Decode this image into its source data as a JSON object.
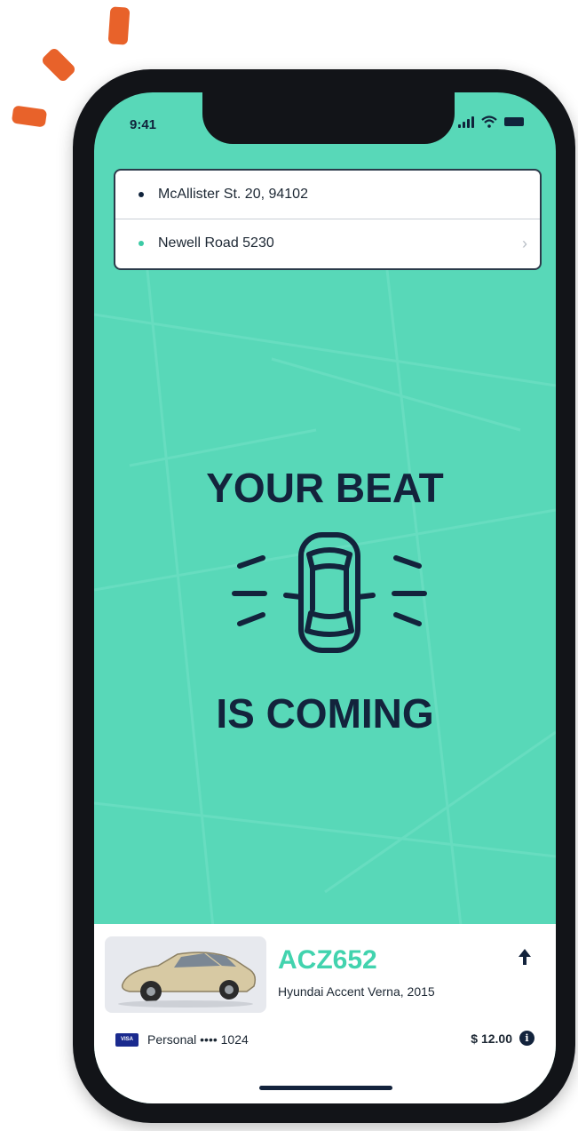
{
  "status_bar": {
    "time": "9:41"
  },
  "route": {
    "pickup": "McAllister St. 20, 94102",
    "destination": "Newell Road 5230"
  },
  "message": {
    "line1": "YOUR BEAT",
    "line2": "IS COMING"
  },
  "vehicle": {
    "plate": "ACZ652",
    "model": "Hyundai Accent Verna, 2015"
  },
  "payment": {
    "card_brand": "VISA",
    "label": "Personal •••• 1024",
    "price": "$ 12.00"
  },
  "colors": {
    "accent": "#58d8b8",
    "plate": "#42d3ae",
    "dark": "#13233c",
    "decor": "#e8622a"
  },
  "icons": [
    "signal-icon",
    "wifi-icon",
    "battery-icon",
    "chevron-right-icon",
    "car-icon",
    "arrow-up-icon",
    "visa-card-icon",
    "info-icon"
  ]
}
